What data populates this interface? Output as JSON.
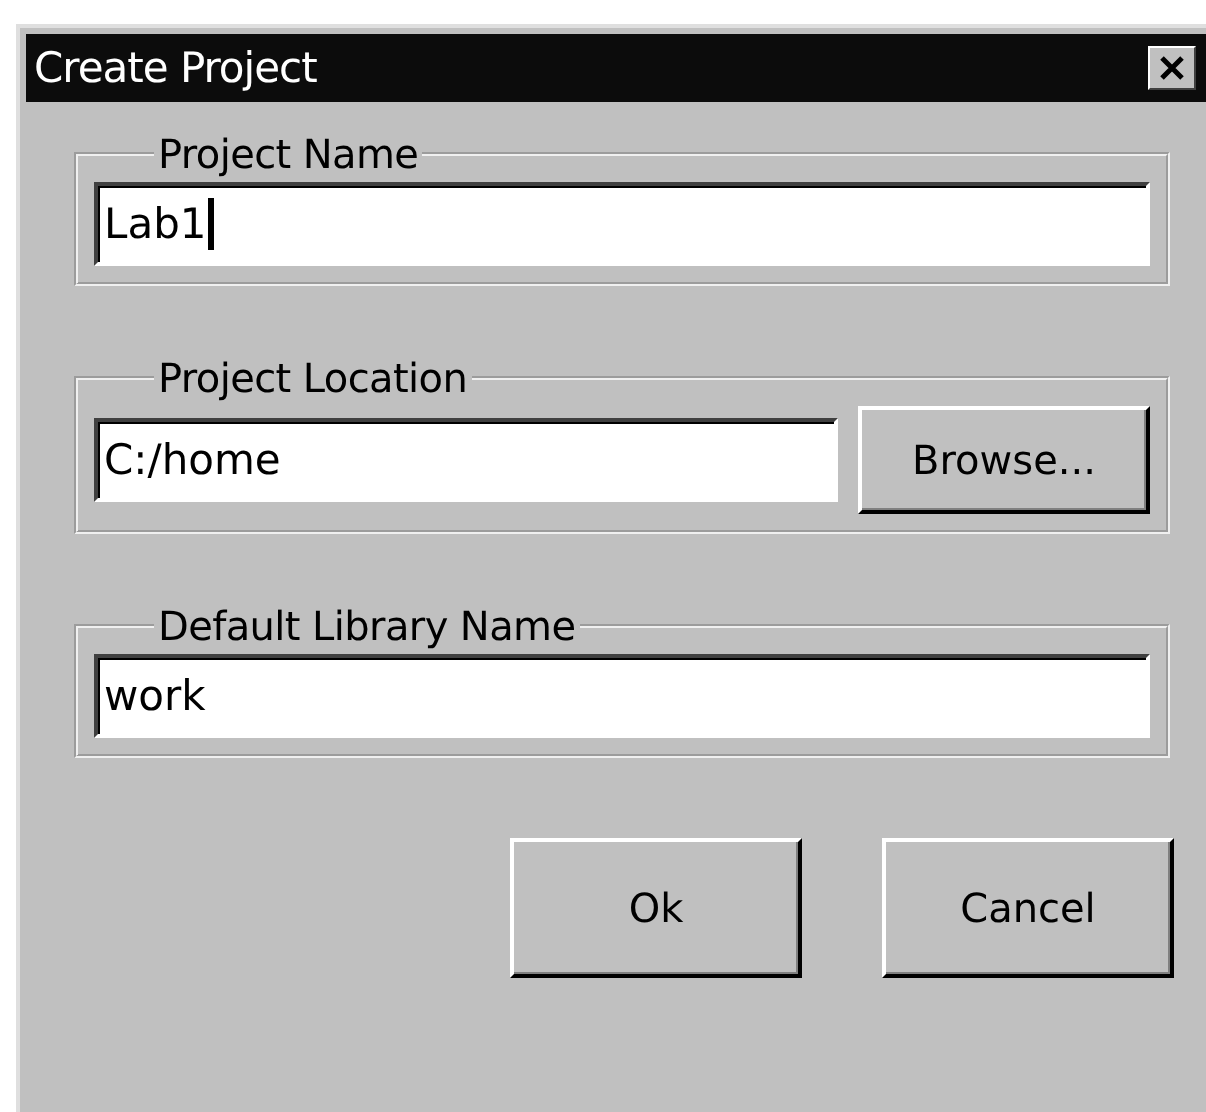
{
  "window": {
    "title": "Create Project"
  },
  "groups": [
    {
      "label": "Project Name",
      "field": {
        "value": "Lab1",
        "focused": true
      }
    },
    {
      "label": "Project Location",
      "field": {
        "value": "C:/home",
        "focused": false
      },
      "button": "Browse..."
    },
    {
      "label": "Default Library Name",
      "field": {
        "value": "work",
        "focused": false
      }
    }
  ],
  "buttons": [
    "Ok",
    "Cancel"
  ]
}
